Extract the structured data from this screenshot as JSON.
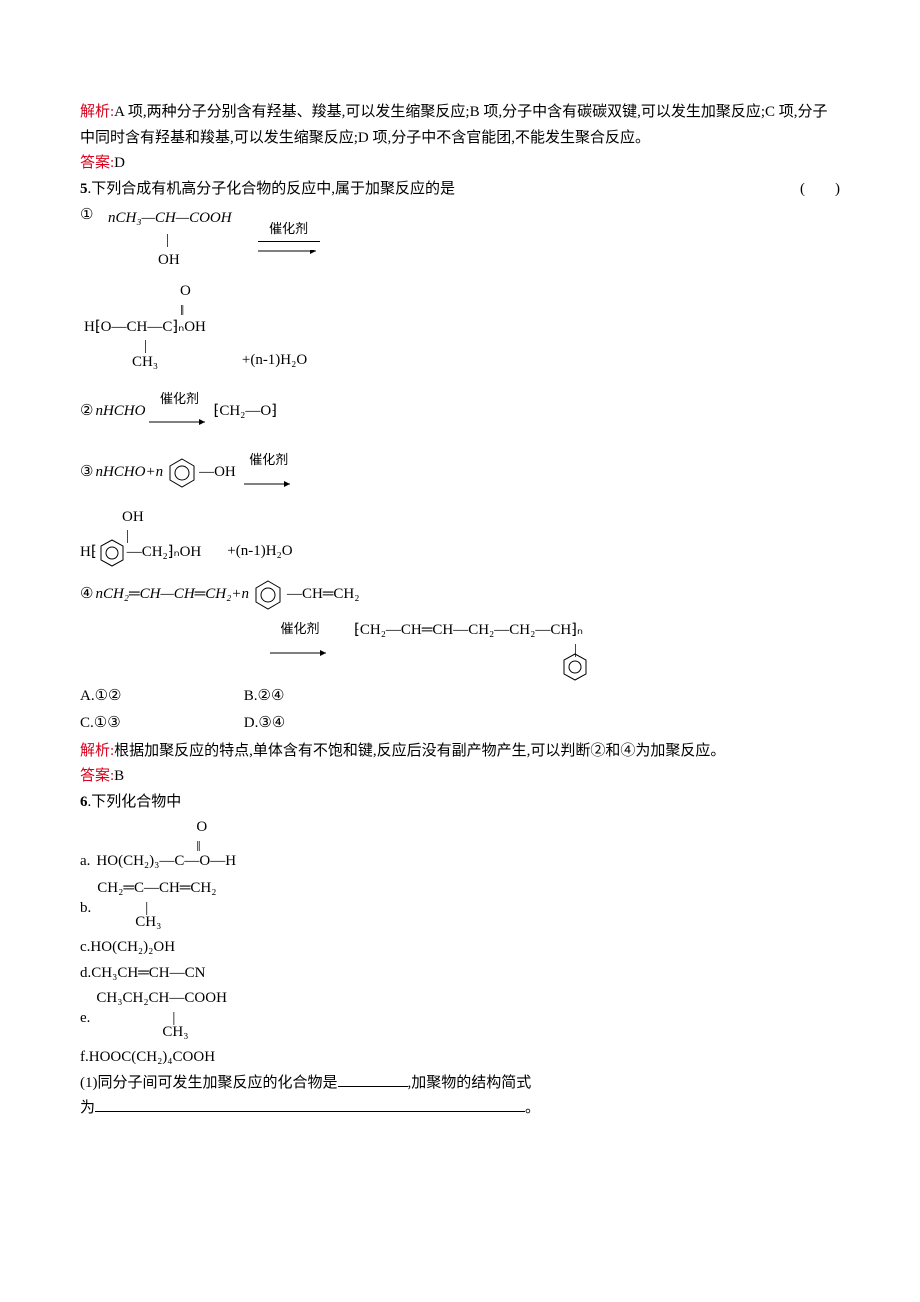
{
  "analysis4": {
    "label": "解析:",
    "text": "A 项,两种分子分别含有羟基、羧基,可以发生缩聚反应;B 项,分子中含有碳碳双键,可以发生加聚反应;C 项,分子中同时含有羟基和羧基,可以发生缩聚反应;D 项,分子中不含官能团,不能发生聚合反应。"
  },
  "answer4": {
    "label": "答案:",
    "value": "D"
  },
  "q5": {
    "number": "5",
    "stem": ".下列合成有机高分子化合物的反应中,属于加聚反应的是",
    "paren": "(　　)",
    "items": {
      "r1_top": "nCH₃—CH—COOH",
      "r1_mid": "OH",
      "r1_catalyst": "催化剂",
      "r1_prod_top": "O",
      "r1_prod_mid": "H⁅O—CH—C⁆ₙOH",
      "r1_prod_bot": "CH₃",
      "r1_by": "+(n-1)H₂O",
      "r2_left": "nHCHO",
      "r2_cat": "催化剂",
      "r2_right": "⁅CH₂—O⁆",
      "r3_left": "nHCHO+n",
      "r3_ph_OH": "OH",
      "r3_cat": "催化剂",
      "r3_prod_top": "OH",
      "r3_prod_mid": "H⁅",
      "r3_prod_right": "—CH₂⁆ₙOH",
      "r3_by": "+(n-1)H₂O",
      "r4_left": "nCH₂═CH—CH═CH₂+n",
      "r4_ph_side": "—CH═CH₂",
      "r4_cat": "催化剂",
      "r4_prod": "⁅CH₂—CH═CH—CH₂—CH₂—CH⁆ₙ"
    },
    "circles": {
      "c1": "①",
      "c2": "②",
      "c3": "③",
      "c4": "④"
    },
    "options": {
      "A": "A.①②",
      "B": "B.②④",
      "C": "C.①③",
      "D": "D.③④"
    },
    "analysis": {
      "label": "解析:",
      "text": "根据加聚反应的特点,单体含有不饱和键,反应后没有副产物产生,可以判断②和④为加聚反应。"
    },
    "answer": {
      "label": "答案:",
      "value": "B"
    }
  },
  "q6": {
    "number": "6",
    "stem": ".下列化合物中",
    "compounds": {
      "a_label": "a.",
      "a_top": "O",
      "a_mid": "HO(CH₂)₃—C—O—H",
      "b_label": "b.",
      "b_top": "CH₂═C—CH═CH₂",
      "b_bot": "CH₃",
      "c": "c.HO(CH₂)₂OH",
      "d": "d.CH₃CH═CH—CN",
      "e_label": "e.",
      "e_top": "CH₃CH₂CH—COOH",
      "e_bot": "CH₃",
      "f": "f.HOOC(CH₂)₄COOH"
    },
    "sub1": {
      "text_a": "(1)同分子间可发生加聚反应的化合物是",
      "blank1_width": 70,
      "text_b": ",加聚物的结构简式",
      "text_c": "为",
      "blank2_width": 430,
      "text_d": "。"
    }
  }
}
